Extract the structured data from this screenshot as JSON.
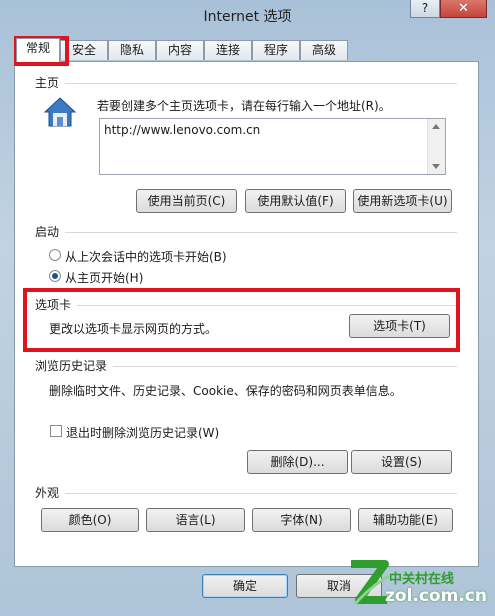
{
  "window": {
    "title": "Internet 选项",
    "help_label": "?",
    "close_label": "✕"
  },
  "tabs": [
    "常规",
    "安全",
    "隐私",
    "内容",
    "连接",
    "程序",
    "高级"
  ],
  "homepage": {
    "heading": "主页",
    "description": "若要创建多个主页选项卡，请在每行输入一个地址(R)。",
    "url_value": "http://www.lenovo.com.cn",
    "use_current": "使用当前页(C)",
    "use_default": "使用默认值(F)",
    "use_new_tab": "使用新选项卡(U)"
  },
  "startup": {
    "heading": "启动",
    "option_last_session": "从上次会话中的选项卡开始(B)",
    "option_homepage": "从主页开始(H)",
    "selected": "homepage"
  },
  "tabs_section": {
    "heading": "选项卡",
    "description": "更改以选项卡显示网页的方式。",
    "button": "选项卡(T)"
  },
  "history": {
    "heading": "浏览历史记录",
    "description": "删除临时文件、历史记录、Cookie、保存的密码和网页表单信息。",
    "checkbox_label": "退出时删除浏览历史记录(W)",
    "checkbox_checked": false,
    "delete_button": "删除(D)...",
    "settings_button": "设置(S)"
  },
  "appearance": {
    "heading": "外观",
    "colors": "颜色(O)",
    "languages": "语言(L)",
    "fonts": "字体(N)",
    "accessibility": "辅助功能(E)"
  },
  "footer": {
    "ok": "确定",
    "cancel": "取消"
  },
  "watermark": {
    "text_cn": "中关村在线",
    "text_en": "zol.com.cn"
  },
  "colors": {
    "highlight_red": "#e0141e",
    "accent": "#3c7fb1",
    "watermark_green": "#2f9e2f"
  }
}
